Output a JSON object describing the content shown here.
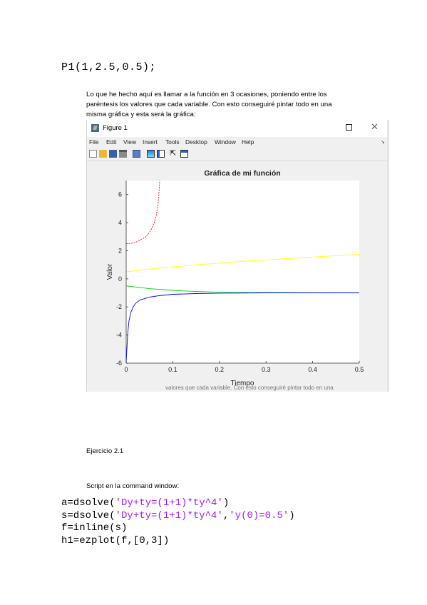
{
  "code_top": "P1(1,2.5,0.5);",
  "paragraph": [
    "Lo que he hecho aquí es llamar a la función en 3 ocasiones, poniendo entre los",
    "paréntesis los valores que cada variable. Con esto conseguiré pintar todo en una",
    "misma gráfica y esta será la gráfica:"
  ],
  "figure": {
    "window_title": "Figure 1",
    "menu": [
      "File",
      "Edit",
      "View",
      "Insert",
      "Tools",
      "Desktop",
      "Window",
      "Help"
    ],
    "toolbar_icons": [
      "new-file-icon",
      "open-folder-icon",
      "save-icon",
      "print-icon",
      "link-icon",
      "colorbar-icon",
      "legend-icon",
      "arrow-pointer-icon",
      "property-editor-icon"
    ],
    "below_text": "valores que cada variable. Con esto conseguiré pintar todo en una"
  },
  "chart_data": {
    "type": "line",
    "title": "Gráfica de mi función",
    "xlabel": "Tiempo",
    "ylabel": "Valor",
    "xlim": [
      0,
      0.5
    ],
    "ylim": [
      -6,
      7
    ],
    "xticks": [
      "0",
      "0.1",
      "0.2",
      "0.3",
      "0.4",
      "0.5"
    ],
    "yticks": [
      "-6",
      "-4",
      "-2",
      "0",
      "2",
      "4",
      "6"
    ],
    "grid": false,
    "series": [
      {
        "color": "#ff0000",
        "x": [
          0,
          0.01,
          0.02,
          0.03,
          0.04,
          0.05,
          0.055,
          0.06,
          0.065,
          0.068,
          0.07,
          0.072
        ],
        "y": [
          2.5,
          2.52,
          2.6,
          2.75,
          2.95,
          3.3,
          3.6,
          4.0,
          4.6,
          5.2,
          6.0,
          7.0
        ]
      },
      {
        "color": "#ffff00",
        "x": [
          0,
          0.05,
          0.1,
          0.15,
          0.2,
          0.25,
          0.3,
          0.35,
          0.4,
          0.45,
          0.5
        ],
        "y": [
          0.5,
          0.7,
          0.85,
          1.0,
          1.12,
          1.25,
          1.35,
          1.45,
          1.55,
          1.65,
          1.75
        ]
      },
      {
        "color": "#00cc00",
        "x": [
          0,
          0.05,
          0.1,
          0.15,
          0.2,
          0.25,
          0.3,
          0.4,
          0.5
        ],
        "y": [
          -0.5,
          -0.7,
          -0.82,
          -0.9,
          -0.95,
          -0.97,
          -0.98,
          -0.99,
          -1.0
        ]
      },
      {
        "color": "#0000ff",
        "x": [
          0,
          0.003,
          0.006,
          0.01,
          0.015,
          0.02,
          0.03,
          0.05,
          0.07,
          0.1,
          0.15,
          0.2,
          0.3,
          0.4,
          0.5
        ],
        "y": [
          -6.0,
          -4.0,
          -3.0,
          -2.4,
          -2.0,
          -1.75,
          -1.5,
          -1.3,
          -1.2,
          -1.1,
          -1.05,
          -1.02,
          -1.0,
          -1.0,
          -1.0
        ]
      }
    ]
  },
  "ejercicio": "Ejercicio 2.1",
  "script_label": "Script en la command window:",
  "code_lines": [
    {
      "pre": "a=dsolve(",
      "str": "'Dy+ty=(1+1)*ty^4'",
      "post": ")"
    },
    {
      "pre": "s=dsolve(",
      "str": "'Dy+ty=(1+1)*ty^4'",
      "mid": ",",
      "str2": "'y(0)=0.5'",
      "post": ")"
    },
    {
      "pre": "f=inline(s)"
    },
    {
      "pre": "h1=ezplot(f,[0,3])"
    }
  ]
}
